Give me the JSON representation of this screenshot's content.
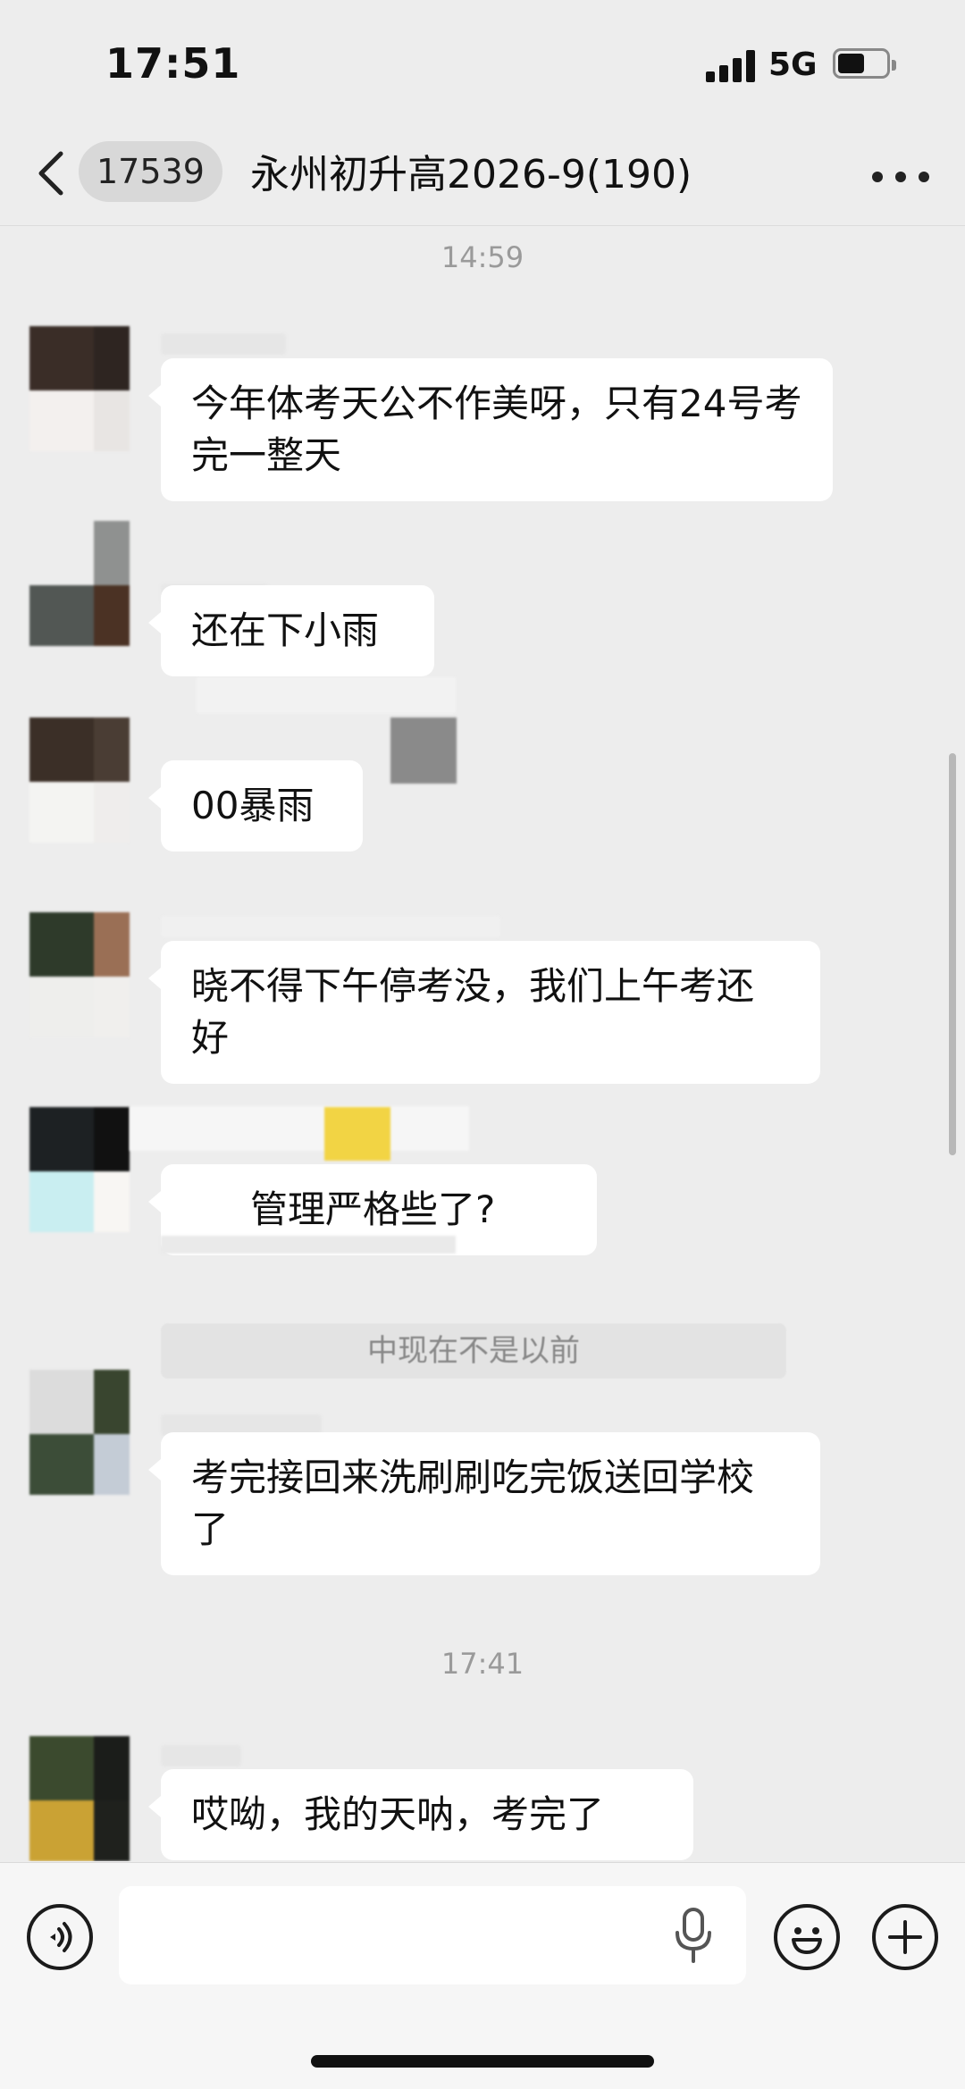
{
  "status_bar": {
    "time": "17:51",
    "network": "5G",
    "battery_level": 0.55,
    "signal_bars": 4
  },
  "nav": {
    "unread_count": "17539",
    "title": "永州初升高2026-9(190)"
  },
  "chat": {
    "timestamps": [
      "14:59",
      "17:41"
    ],
    "messages": [
      {
        "text": "今年体考天公不作美呀，只有24号考完一整天"
      },
      {
        "text": "还在下小雨"
      },
      {
        "text": "00暴雨"
      },
      {
        "text": "晓不得下午停考没，我们上午考还好"
      },
      {
        "text": "管理严格些了?"
      },
      {
        "text": "考完接回来洗刷刷吃完饭送回学校了"
      },
      {
        "text": "哎呦，我的天呐，考完了"
      }
    ],
    "system_message": "中现在不是以前"
  },
  "input_bar": {
    "placeholder": ""
  },
  "icons": {
    "back": "chevron-left-icon",
    "more": "more-dots-icon",
    "voice": "voice-wave-icon",
    "mic": "microphone-icon",
    "emoji": "smiley-icon",
    "plus": "plus-icon"
  }
}
